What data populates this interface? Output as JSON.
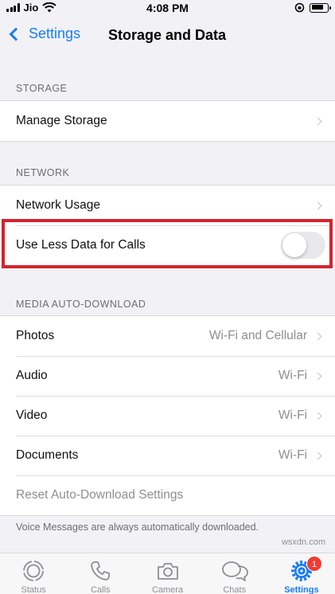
{
  "status_bar": {
    "carrier": "Jio",
    "time": "4:08 PM",
    "battery_level": 0.8
  },
  "nav": {
    "back_label": "Settings",
    "title": "Storage and Data"
  },
  "sections": {
    "storage": {
      "header": "STORAGE",
      "manage_storage": "Manage Storage"
    },
    "network": {
      "header": "NETWORK",
      "network_usage": "Network Usage",
      "use_less_data": "Use Less Data for Calls",
      "use_less_data_enabled": false
    },
    "media": {
      "header": "MEDIA AUTO-DOWNLOAD",
      "items": [
        {
          "label": "Photos",
          "value": "Wi-Fi and Cellular"
        },
        {
          "label": "Audio",
          "value": "Wi-Fi"
        },
        {
          "label": "Video",
          "value": "Wi-Fi"
        },
        {
          "label": "Documents",
          "value": "Wi-Fi"
        }
      ],
      "reset": "Reset Auto-Download Settings",
      "footer": "Voice Messages are always automatically downloaded."
    }
  },
  "tabs": [
    {
      "label": "Status",
      "icon": "status-icon"
    },
    {
      "label": "Calls",
      "icon": "phone-icon"
    },
    {
      "label": "Camera",
      "icon": "camera-icon"
    },
    {
      "label": "Chats",
      "icon": "chats-icon"
    },
    {
      "label": "Settings",
      "icon": "gear-icon",
      "active": true,
      "badge": "1"
    }
  ],
  "watermark": "wsxdn.com",
  "colors": {
    "accent": "#1a7cf5",
    "highlight_border": "#d4232e",
    "badge": "#f23a35"
  }
}
